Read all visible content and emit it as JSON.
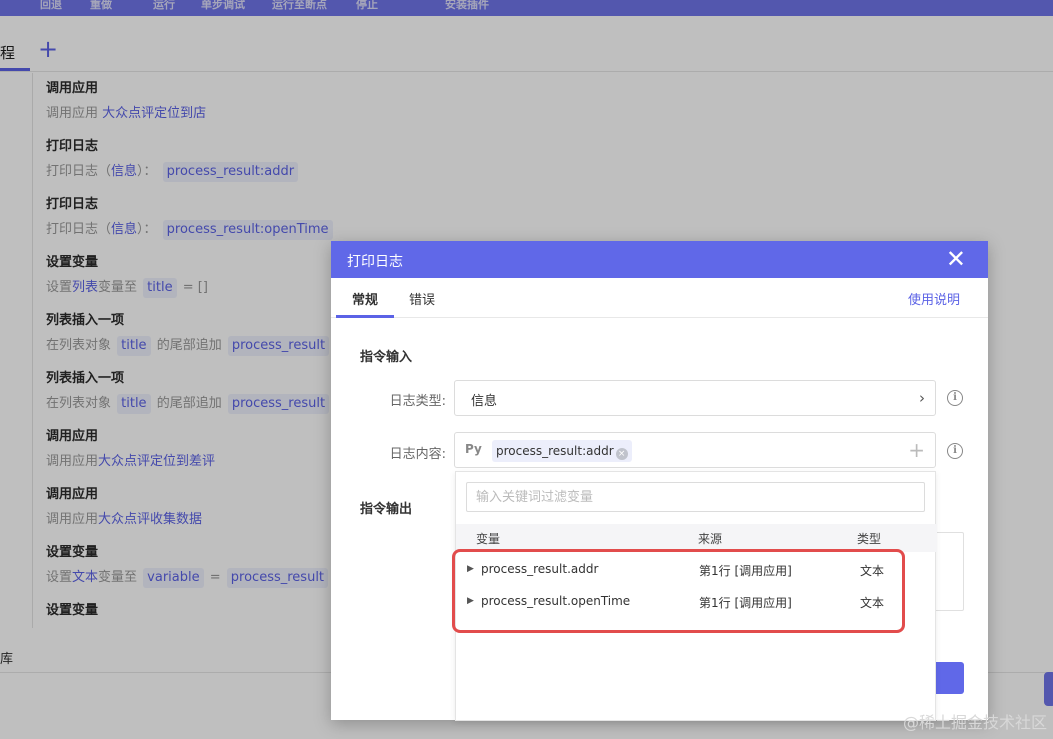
{
  "toolbar": {
    "items": [
      "回退",
      "重做",
      "运行",
      "单步调试",
      "运行至断点",
      "停止",
      "安装插件"
    ]
  },
  "tabbar": {
    "tab_label": "程",
    "add": "+"
  },
  "commands": [
    {
      "title": "调用应用",
      "desc": [
        {
          "t": "调用应用 "
        },
        {
          "t": "大众点评定位到店",
          "s": "link"
        }
      ]
    },
    {
      "title": "打印日志",
      "desc": [
        {
          "t": "打印日志（"
        },
        {
          "t": "信息",
          "s": "link"
        },
        {
          "t": "）： "
        },
        {
          "t": "process_result:addr",
          "s": "chip"
        }
      ]
    },
    {
      "title": "打印日志",
      "desc": [
        {
          "t": "打印日志（"
        },
        {
          "t": "信息",
          "s": "link"
        },
        {
          "t": "）： "
        },
        {
          "t": "process_result:openTime",
          "s": "chip"
        }
      ]
    },
    {
      "title": "设置变量",
      "desc": [
        {
          "t": "设置"
        },
        {
          "t": "列表",
          "s": "link"
        },
        {
          "t": "变量至 "
        },
        {
          "t": "title",
          "s": "chip"
        },
        {
          "t": " = []"
        }
      ]
    },
    {
      "title": "列表插入一项",
      "desc": [
        {
          "t": "在列表对象 "
        },
        {
          "t": "title",
          "s": "chip"
        },
        {
          "t": " 的尾部追加 "
        },
        {
          "t": "process_result",
          "s": "chip"
        }
      ]
    },
    {
      "title": "列表插入一项",
      "desc": [
        {
          "t": "在列表对象 "
        },
        {
          "t": "title",
          "s": "chip"
        },
        {
          "t": " 的尾部追加 "
        },
        {
          "t": "process_result",
          "s": "chip"
        }
      ]
    },
    {
      "title": "调用应用",
      "desc": [
        {
          "t": "调用应用"
        },
        {
          "t": "大众点评定位到差评",
          "s": "link"
        }
      ]
    },
    {
      "title": "调用应用",
      "desc": [
        {
          "t": "调用应用"
        },
        {
          "t": "大众点评收集数据",
          "s": "link"
        }
      ]
    },
    {
      "title": "设置变量",
      "desc": [
        {
          "t": "设置"
        },
        {
          "t": "文本",
          "s": "link"
        },
        {
          "t": "变量至 "
        },
        {
          "t": "variable",
          "s": "chip"
        },
        {
          "t": " = "
        },
        {
          "t": "process_result",
          "s": "chip"
        }
      ]
    },
    {
      "title": "设置变量",
      "desc": []
    }
  ],
  "bottom_panel": {
    "label": "库"
  },
  "dialog": {
    "title": "打印日志",
    "close_glyph": "✕",
    "tabs": [
      "常规",
      "错误"
    ],
    "help_link": "使用说明",
    "input_section": "指令输入",
    "output_section": "指令输出",
    "log_type": {
      "label": "日志类型:",
      "value": "信息",
      "chevron": "›"
    },
    "log_content": {
      "label": "日志内容:",
      "py": "Py",
      "tag": "process_result:addr",
      "tag_remove": "×",
      "add": "+"
    },
    "info_glyph": "i",
    "confirm_partial": "定"
  },
  "dropdown": {
    "filter_placeholder": "输入关键词过滤变量",
    "columns": {
      "var": "变量",
      "source": "来源",
      "type": "类型"
    },
    "rows": [
      {
        "caret": "▶",
        "name": "process_result.addr",
        "source": "第1行 [调用应用]",
        "type": "文本"
      },
      {
        "caret": "▶",
        "name": "process_result.openTime",
        "source": "第1行 [调用应用]",
        "type": "文本"
      }
    ]
  },
  "watermark": "@稀土掘金技术社区"
}
